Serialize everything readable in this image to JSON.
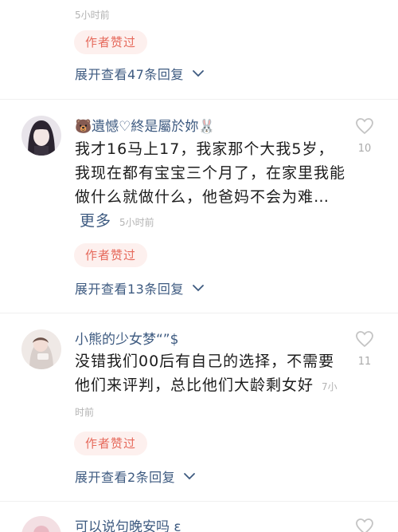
{
  "top": {
    "time": "5小时前",
    "author_praise": "作者赞过",
    "expand": "展开查看47条回复"
  },
  "comments": [
    {
      "name": "🐻遺憾♡終是屬於妳🐰",
      "text": "我才16马上17，我家那个大我5岁，我现在都有宝宝三个月了，在家里我能做什么就做什么，他爸妈不会为难…",
      "more": "更多",
      "time": "5小时前",
      "likes": "10",
      "author_praise": "作者赞过",
      "expand": "展开查看13条回复"
    },
    {
      "name": "小熊的少女梦“”$",
      "text": "没错我们00后有自己的选择，不需要他们来评判，总比他们大龄剩女好",
      "time": "7小时前",
      "likes": "11",
      "author_praise": "作者赞过",
      "expand": "展开查看2条回复"
    },
    {
      "name": "可以说句晚安吗 ε"
    }
  ],
  "colors": {
    "link": "#3d5a80",
    "praise_text": "#e66a5c",
    "praise_bg": "#fdf0ee",
    "muted": "#b3b3b3"
  }
}
